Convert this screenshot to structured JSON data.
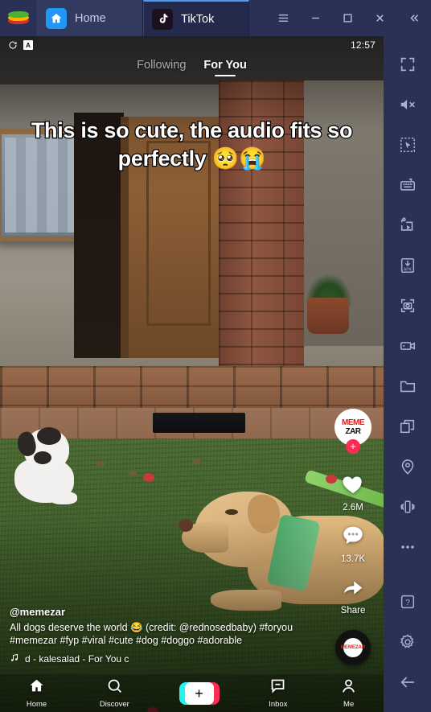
{
  "window": {
    "app_logo": "bluestacks-logo",
    "tabs": [
      {
        "label": "Home",
        "icon": "home-icon",
        "active": false
      },
      {
        "label": "TikTok",
        "icon": "tiktok-note-icon",
        "active": true
      }
    ],
    "controls": [
      {
        "name": "menu-button",
        "icon": "hamburger-icon"
      },
      {
        "name": "minimize-button",
        "icon": "minimize-icon"
      },
      {
        "name": "maximize-button",
        "icon": "maximize-icon"
      },
      {
        "name": "close-button",
        "icon": "close-icon"
      },
      {
        "name": "collapse-sidebar-button",
        "icon": "chevron-double-left-icon"
      }
    ]
  },
  "statusbar": {
    "rotate_icon": "rotate-screen-icon",
    "badge": "A",
    "time": "12:57"
  },
  "feed": {
    "tabs": [
      {
        "label": "Following",
        "active": false
      },
      {
        "label": "For You",
        "active": true
      }
    ]
  },
  "video": {
    "overlay_text": "This is so cute, the audio fits so perfectly 🥺😭",
    "scene_description": "two dogs on lawn in front of a house"
  },
  "actions": {
    "avatar": {
      "line1": "MEME",
      "line2": "ZAR",
      "follow_label": "+"
    },
    "like": {
      "icon": "heart-icon",
      "count": "2.6M"
    },
    "comment": {
      "icon": "comment-icon",
      "count": "13.7K"
    },
    "share": {
      "icon": "share-arrow-icon",
      "label": "Share"
    },
    "music_disc": {
      "icon": "music-disc-icon",
      "label": "MEMEZAR"
    }
  },
  "caption": {
    "username": "@memezar",
    "text": "All dogs deserve the world 😂 (credit: @rednosedbaby) #foryou #memezar #fyp #viral #cute #dog #doggo #adorable",
    "music_icon": "music-note-icon",
    "music": "d - kalesalad - For You   c"
  },
  "bottom_nav": [
    {
      "label": "Home",
      "icon": "home-icon",
      "active": true
    },
    {
      "label": "Discover",
      "icon": "search-icon",
      "active": false
    },
    {
      "label": "",
      "icon": "plus-create-icon",
      "active": false
    },
    {
      "label": "Inbox",
      "icon": "inbox-icon",
      "active": false
    },
    {
      "label": "Me",
      "icon": "person-icon",
      "active": false
    }
  ],
  "sidebar": {
    "items": [
      {
        "name": "fullscreen",
        "icon": "fullscreen-icon"
      },
      {
        "name": "mute",
        "icon": "speaker-mute-icon"
      },
      {
        "name": "multi-select",
        "icon": "marquee-pointer-icon"
      },
      {
        "name": "game-controls",
        "icon": "keyboard-icon"
      },
      {
        "name": "macro-recorder",
        "icon": "macro-play-icon"
      },
      {
        "name": "install-apk",
        "icon": "apk-download-icon"
      },
      {
        "name": "screenshot",
        "icon": "camera-screenshot-icon"
      },
      {
        "name": "screen-record",
        "icon": "video-record-icon"
      },
      {
        "name": "media-manager",
        "icon": "folder-icon"
      },
      {
        "name": "multi-instance",
        "icon": "copy-windows-icon"
      },
      {
        "name": "location",
        "icon": "location-pin-icon"
      },
      {
        "name": "shake",
        "icon": "shake-phone-icon"
      },
      {
        "name": "more",
        "icon": "ellipsis-icon"
      },
      {
        "name": "help",
        "icon": "question-help-icon"
      },
      {
        "name": "settings",
        "icon": "gear-icon"
      },
      {
        "name": "back",
        "icon": "back-arrow-icon"
      }
    ]
  },
  "colors": {
    "titlebar_bg": "#2b3154",
    "sidebar_bg": "#2b3154",
    "accent_pink": "#fe2c55",
    "accent_cyan": "#25f4ee"
  }
}
